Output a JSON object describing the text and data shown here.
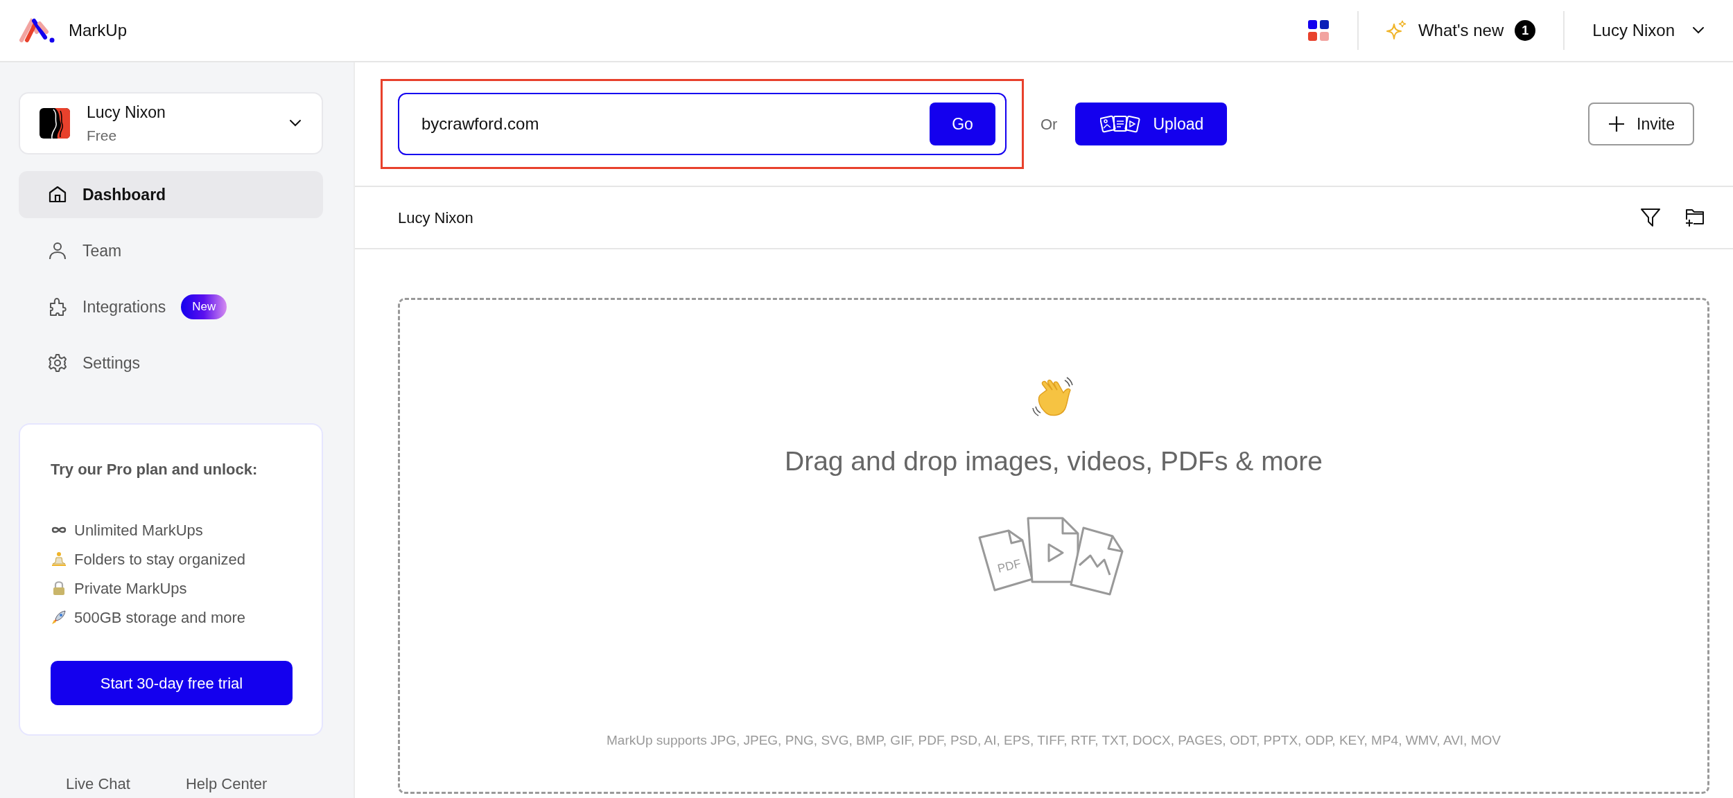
{
  "app": {
    "name": "MarkUp"
  },
  "header": {
    "whats_new": {
      "label": "What's new",
      "count": "1"
    },
    "user": "Lucy Nixon"
  },
  "account": {
    "name": "Lucy Nixon",
    "plan": "Free"
  },
  "nav": [
    {
      "kind": "home",
      "label": "Dashboard",
      "selected": true
    },
    {
      "kind": "person",
      "label": "Team",
      "selected": false
    },
    {
      "kind": "puzzle",
      "label": "Integrations",
      "selected": false,
      "badge": "New"
    },
    {
      "kind": "gear",
      "label": "Settings",
      "selected": false
    }
  ],
  "promo": {
    "title": "Try our Pro plan and unlock:",
    "features": [
      {
        "kind": "infinity",
        "text": "Unlimited MarkUps"
      },
      {
        "kind": "meditation",
        "text": "Folders to stay organized"
      },
      {
        "kind": "lock",
        "text": "Private MarkUps"
      },
      {
        "kind": "rocket",
        "text": "500GB storage and more"
      }
    ],
    "button": "Start 30-day free trial"
  },
  "footer_links": [
    "Live Chat",
    "Help Center"
  ],
  "url_bar": {
    "value": "bycrawford.com",
    "button": "Go",
    "highlighted": true
  },
  "or_label": "Or",
  "upload_button": "Upload",
  "invite_button": "Invite",
  "breadcrumb": "Lucy Nixon",
  "dropzone": {
    "heading": "Drag and drop images, videos, PDFs & more",
    "file_label": "PDF",
    "supports": "MarkUp supports JPG, JPEG, PNG, SVG, BMP, GIF, PDF, PSD, AI, EPS, TIFF, RTF, TXT, DOCX, PAGES, ODT, PPTX, ODP, KEY, MP4, WMV, AVI, MOV"
  }
}
